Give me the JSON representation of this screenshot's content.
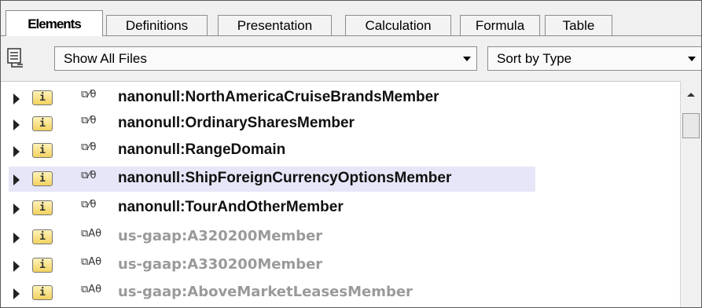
{
  "tabs": [
    {
      "label": "Elements",
      "active": true
    },
    {
      "label": "Definitions",
      "active": false
    },
    {
      "label": "Presentation",
      "active": false
    },
    {
      "label": "Calculation",
      "active": false
    },
    {
      "label": "Formula",
      "active": false
    },
    {
      "label": "Table",
      "active": false
    }
  ],
  "toolbar": {
    "files_combo": "Show All Files",
    "sort_combo": "Sort by Type",
    "icon": "tree-view-icon"
  },
  "elements": [
    {
      "badge": "i",
      "flags": "⧉⁄θ",
      "name": "nanonull:NorthAmericaCruiseBrandsMember",
      "dim": false,
      "selected": false
    },
    {
      "badge": "i",
      "flags": "⧉⁄θ",
      "name": "nanonull:OrdinarySharesMember",
      "dim": false,
      "selected": false
    },
    {
      "badge": "i",
      "flags": "⧉⁄θ",
      "name": "nanonull:RangeDomain",
      "dim": false,
      "selected": false
    },
    {
      "badge": "i",
      "flags": "⧉⁄θ",
      "name": "nanonull:ShipForeignCurrencyOptionsMember",
      "dim": false,
      "selected": true
    },
    {
      "badge": "i",
      "flags": "⧉⁄θ",
      "name": "nanonull:TourAndOtherMember",
      "dim": false,
      "selected": false
    },
    {
      "badge": "i",
      "flags": "⧉Αθ",
      "name": "us-gaap:A320200Member",
      "dim": true,
      "selected": false
    },
    {
      "badge": "i",
      "flags": "⧉Αθ",
      "name": "us-gaap:A330200Member",
      "dim": true,
      "selected": false
    },
    {
      "badge": "i",
      "flags": "⧉Αθ",
      "name": "us-gaap:AboveMarketLeasesMember",
      "dim": true,
      "selected": false
    }
  ]
}
